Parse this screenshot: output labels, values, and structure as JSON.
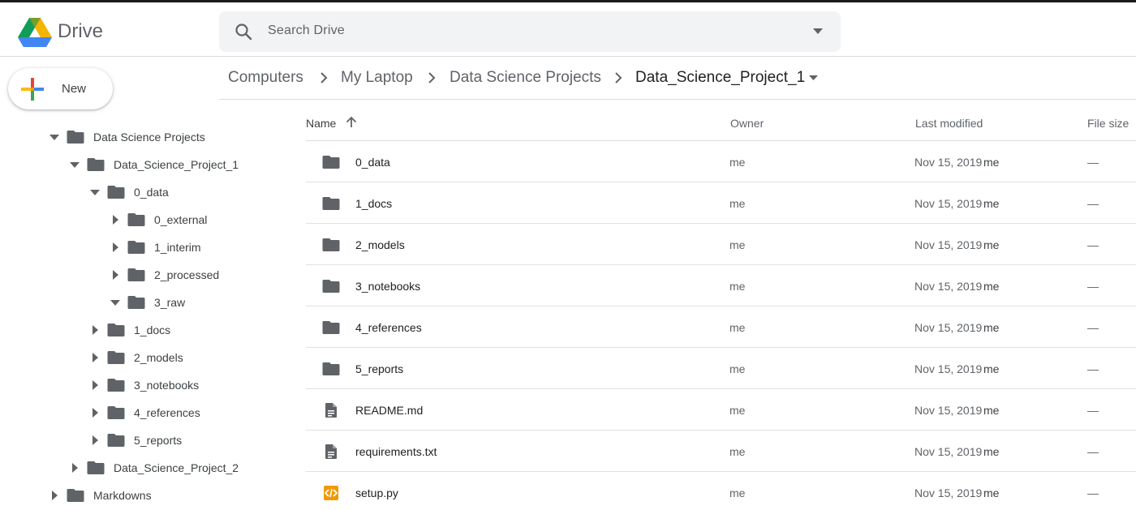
{
  "app": {
    "brand": "Drive",
    "search_placeholder": "Search Drive",
    "new_label": "New"
  },
  "breadcrumb": [
    "Computers",
    "My Laptop",
    "Data Science Projects",
    "Data_Science_Project_1"
  ],
  "tree": [
    {
      "label": "Data Science Projects",
      "depth": 0,
      "state": "expanded"
    },
    {
      "label": "Data_Science_Project_1",
      "depth": 1,
      "state": "expanded"
    },
    {
      "label": "0_data",
      "depth": 2,
      "state": "expanded"
    },
    {
      "label": "0_external",
      "depth": 3,
      "state": "collapsed"
    },
    {
      "label": "1_interim",
      "depth": 3,
      "state": "collapsed"
    },
    {
      "label": "2_processed",
      "depth": 3,
      "state": "collapsed"
    },
    {
      "label": "3_raw",
      "depth": 3,
      "state": "expanded"
    },
    {
      "label": "1_docs",
      "depth": 2,
      "state": "collapsed"
    },
    {
      "label": "2_models",
      "depth": 2,
      "state": "collapsed"
    },
    {
      "label": "3_notebooks",
      "depth": 2,
      "state": "collapsed"
    },
    {
      "label": "4_references",
      "depth": 2,
      "state": "collapsed"
    },
    {
      "label": "5_reports",
      "depth": 2,
      "state": "collapsed"
    },
    {
      "label": "Data_Science_Project_2",
      "depth": 1,
      "state": "collapsed"
    },
    {
      "label": "Markdowns",
      "depth": 0,
      "state": "collapsed"
    }
  ],
  "columns": {
    "name": "Name",
    "owner": "Owner",
    "modified": "Last modified",
    "size": "File size"
  },
  "files": [
    {
      "name": "0_data",
      "type": "folder",
      "owner": "me",
      "modified": "Nov 15, 2019",
      "modified_by": "me",
      "size": "—"
    },
    {
      "name": "1_docs",
      "type": "folder",
      "owner": "me",
      "modified": "Nov 15, 2019",
      "modified_by": "me",
      "size": "—"
    },
    {
      "name": "2_models",
      "type": "folder",
      "owner": "me",
      "modified": "Nov 15, 2019",
      "modified_by": "me",
      "size": "—"
    },
    {
      "name": "3_notebooks",
      "type": "folder",
      "owner": "me",
      "modified": "Nov 15, 2019",
      "modified_by": "me",
      "size": "—"
    },
    {
      "name": "4_references",
      "type": "folder",
      "owner": "me",
      "modified": "Nov 15, 2019",
      "modified_by": "me",
      "size": "—"
    },
    {
      "name": "5_reports",
      "type": "folder",
      "owner": "me",
      "modified": "Nov 15, 2019",
      "modified_by": "me",
      "size": "—"
    },
    {
      "name": "README.md",
      "type": "doc",
      "owner": "me",
      "modified": "Nov 15, 2019",
      "modified_by": "me",
      "size": "—"
    },
    {
      "name": "requirements.txt",
      "type": "doc",
      "owner": "me",
      "modified": "Nov 15, 2019",
      "modified_by": "me",
      "size": "—"
    },
    {
      "name": "setup.py",
      "type": "code",
      "owner": "me",
      "modified": "Nov 15, 2019",
      "modified_by": "me",
      "size": "—"
    }
  ],
  "colors": {
    "folder": "#5f6368",
    "doc": "#5f6368",
    "code_orange": "#f29900",
    "logo_green": "#0f9d58",
    "logo_yellow": "#f4b400",
    "logo_blue": "#4285f4"
  }
}
